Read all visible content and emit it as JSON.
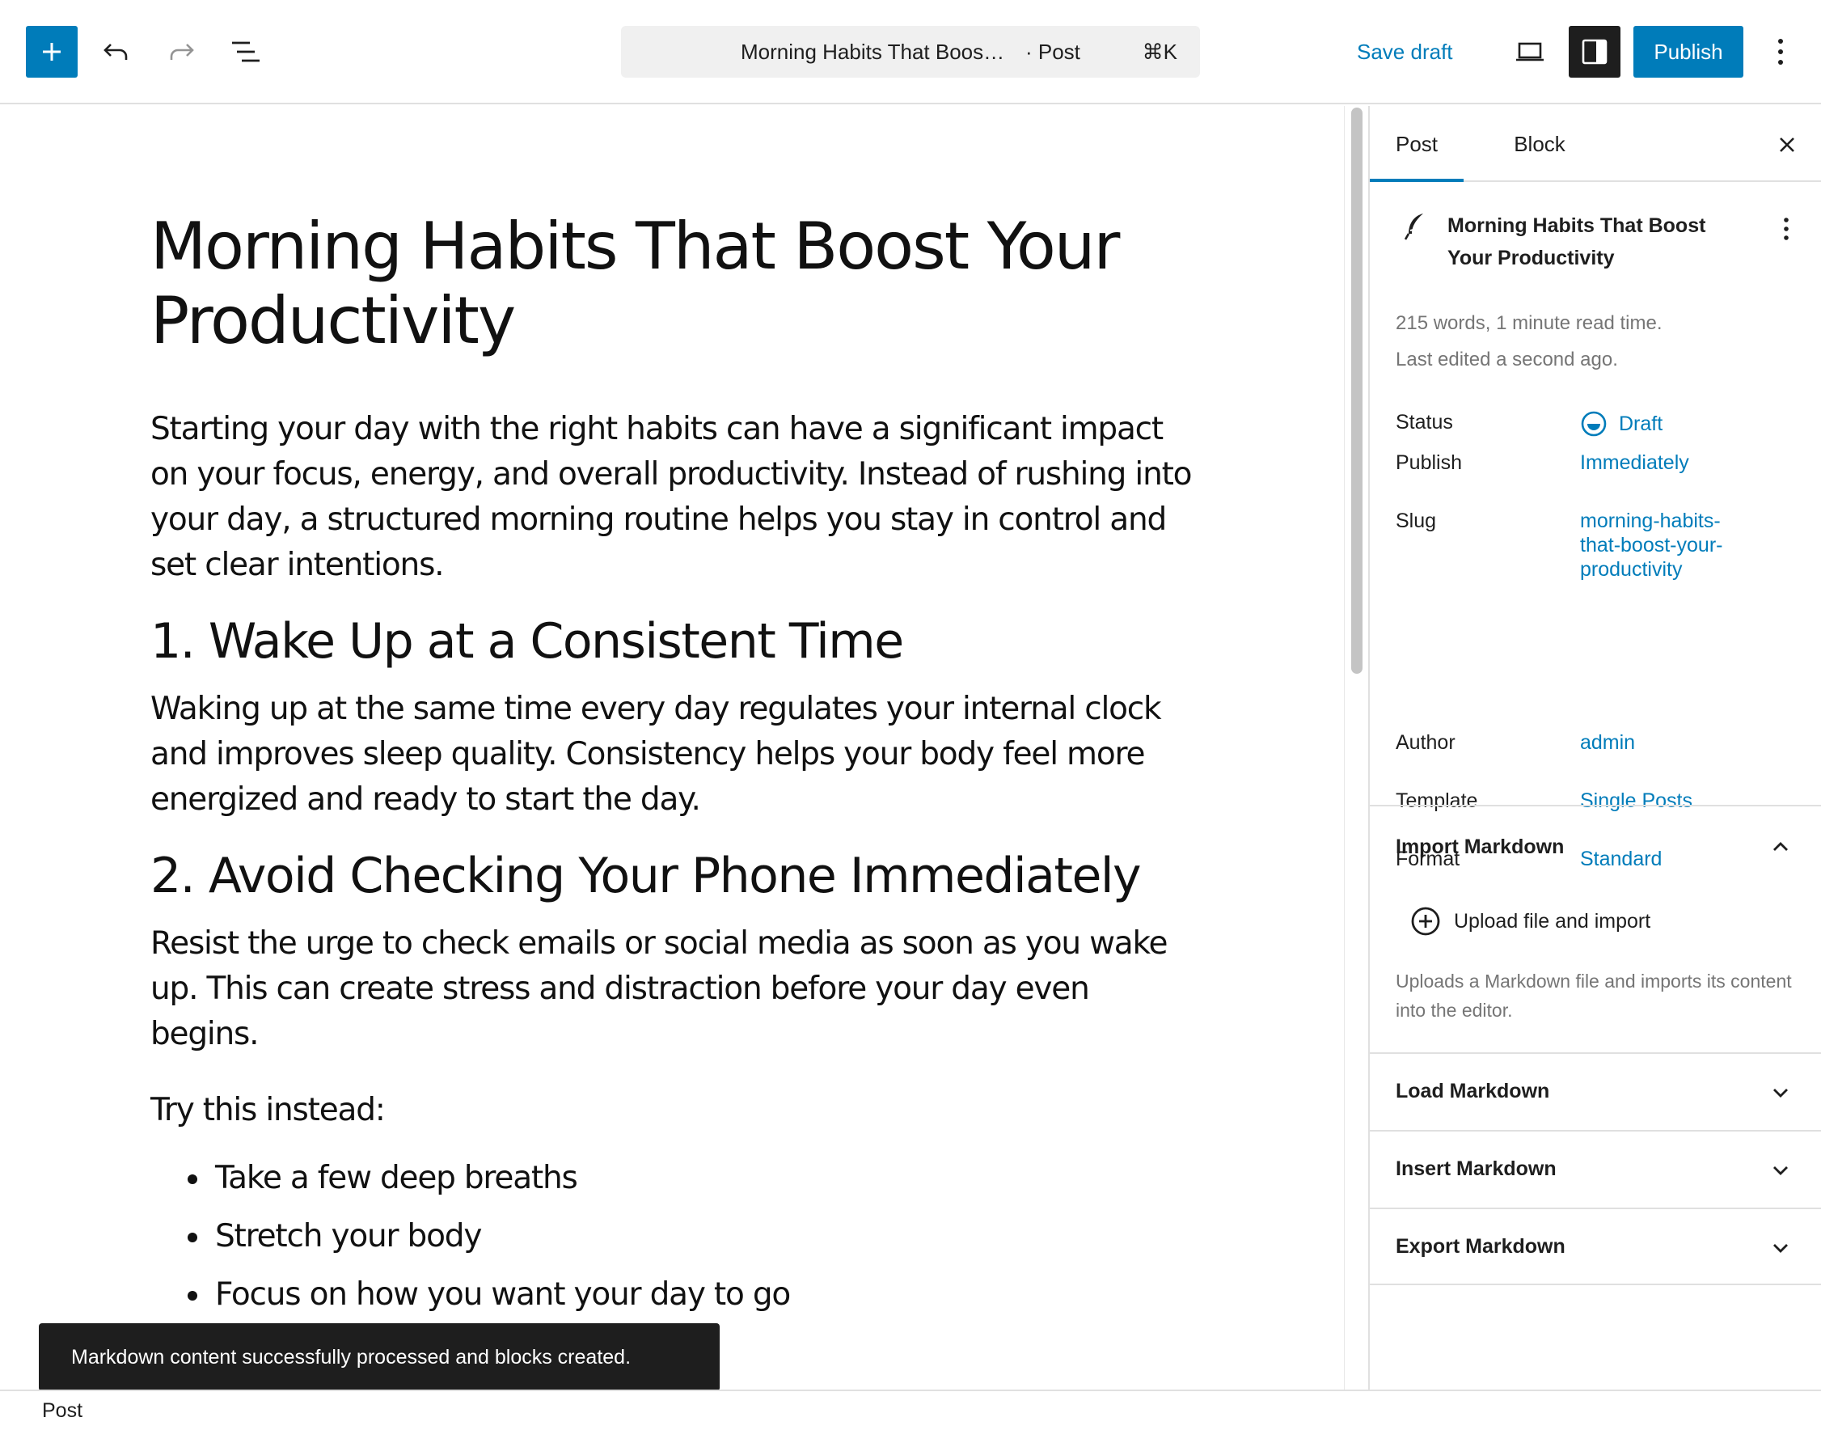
{
  "toolbar": {
    "command_title": "Morning Habits That Boos…",
    "command_type": "· Post",
    "command_shortcut": "⌘K",
    "save_draft": "Save draft",
    "publish": "Publish",
    "icons": {
      "inserter": "plus-icon",
      "undo": "undo-icon",
      "redo": "redo-icon",
      "list_view": "list-view-icon",
      "preview": "laptop-preview-icon",
      "settings": "sidebar-toggle-icon",
      "options": "vertical-ellipsis-icon"
    },
    "colors": {
      "accent": "#007cba",
      "dark": "#1e1e1e"
    }
  },
  "post": {
    "title": "Morning Habits That Boost Your Productivity",
    "intro": "Starting your day with the right habits can have a significant impact on your focus, energy, and overall productivity. Instead of rushing into your day, a structured morning routine helps you stay in control and set clear intentions.",
    "h2_1": "1. Wake Up at a Consistent Time",
    "p_1": "Waking up at the same time every day regulates your internal clock and improves sleep quality. Consistency helps your body feel more energized and ready to start the day.",
    "h2_2": "2. Avoid Checking Your Phone Immediately",
    "p_2": "Resist the urge to check emails or social media as soon as you wake up. This can create stress and distraction before your day even begins.",
    "p_3": "Try this instead:",
    "bullets": [
      "Take a few deep breaths",
      "Stretch your body",
      "Focus on how you want your day to go"
    ]
  },
  "sidebar": {
    "tabs": {
      "post": "Post",
      "block": "Block"
    },
    "doc_title": "Morning Habits That Boost Your Productivity",
    "words": "215 words, 1 minute read time.",
    "last_edited": "Last edited a second ago.",
    "rows": {
      "status": {
        "label": "Status",
        "value": "Draft"
      },
      "publish": {
        "label": "Publish",
        "value": "Immediately"
      },
      "slug": {
        "label": "Slug",
        "value": "morning-habits-that-boost-your-productivity",
        "lines": [
          "morning-habits-",
          "that-boost-your-",
          "productivity"
        ]
      },
      "author": {
        "label": "Author",
        "value": "admin"
      },
      "template": {
        "label": "Template",
        "value": "Single Posts"
      },
      "format": {
        "label": "Format",
        "value": "Standard"
      }
    },
    "panels": {
      "import": {
        "title": "Import Markdown",
        "button": "Upload file and import",
        "help": "Uploads a Markdown file and imports its content into the editor."
      },
      "load": {
        "title": "Load Markdown"
      },
      "insert": {
        "title": "Insert Markdown"
      },
      "export": {
        "title": "Export Markdown"
      }
    }
  },
  "snackbar": {
    "message": "Markdown content successfully processed and blocks created."
  },
  "footer": {
    "breadcrumb": "Post"
  }
}
